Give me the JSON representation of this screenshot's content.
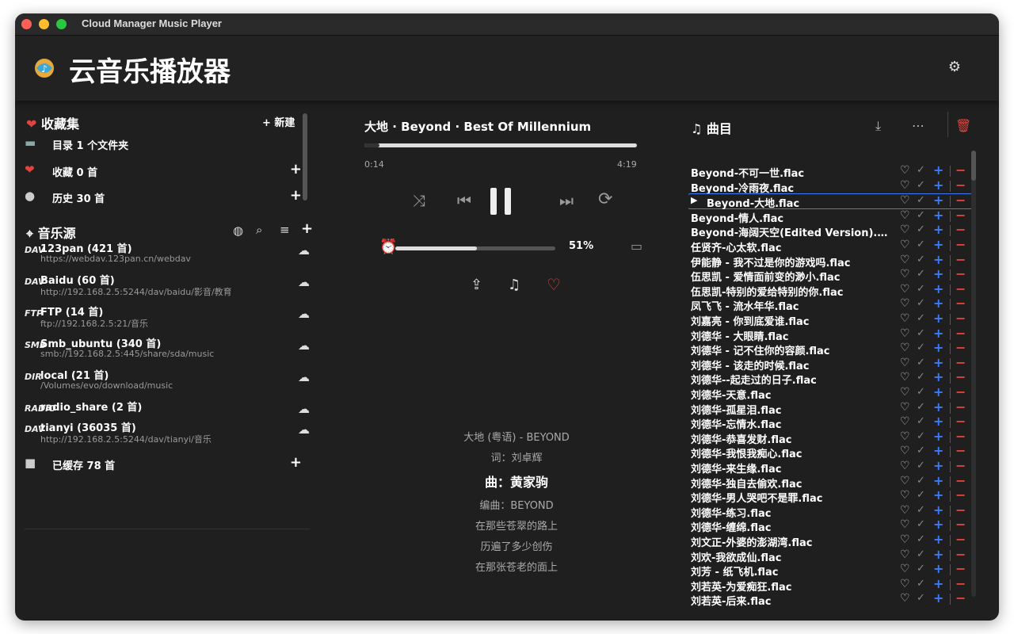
{
  "window": {
    "title": "Cloud Manager Music Player"
  },
  "app": {
    "title": "云音乐播放器"
  },
  "favorites": {
    "title": "收藏集",
    "new_label": "+ 新建",
    "items": [
      {
        "label": "目录 1 个文件夹"
      },
      {
        "label": "收藏 0 首"
      },
      {
        "label": "历史 30 首"
      }
    ]
  },
  "sources": {
    "title": "音乐源",
    "items": [
      {
        "icon": "DAV",
        "name": "123pan (421 首)",
        "url": "https://webdav.123pan.cn/webdav"
      },
      {
        "icon": "DAV",
        "name": "Baidu (60 首)",
        "url": "http://192.168.2.5:5244/dav/baidu/影音/教育"
      },
      {
        "icon": "FTP",
        "name": "FTP (14 首)",
        "url": "ftp://192.168.2.5:21/音乐"
      },
      {
        "icon": "SMB",
        "name": "Smb_ubuntu (340 首)",
        "url": "smb://192.168.2.5:445/share/sda/music"
      },
      {
        "icon": "DIR",
        "name": "local (21 首)",
        "url": "/Volumes/evo/download/music"
      },
      {
        "icon": "RADIO",
        "name": "radio_share (2 首)",
        "url": ""
      },
      {
        "icon": "DAV",
        "name": "tianyi (36035 首)",
        "url": "http://192.168.2.5:5244/dav/tianyi/音乐"
      }
    ]
  },
  "cached": {
    "label": "已缓存 78 首"
  },
  "player": {
    "now_playing": "大地 · Beyond · Best Of Millennium",
    "elapsed": "0:14",
    "duration": "4:19",
    "progress": 0.054,
    "volume_pct": "51%",
    "volume": 0.51
  },
  "lyrics": [
    {
      "text": "大地 (粤语) - BEYOND",
      "hl": false
    },
    {
      "text": "词：刘卓辉",
      "hl": false
    },
    {
      "text": "曲：黄家驹",
      "hl": true
    },
    {
      "text": "编曲：BEYOND",
      "hl": false
    },
    {
      "text": "在那些苍翠的路上",
      "hl": false
    },
    {
      "text": "历遍了多少创伤",
      "hl": false
    },
    {
      "text": "在那张苍老的面上",
      "hl": false
    }
  ],
  "playlist": {
    "title": "曲目",
    "selected_index": 2,
    "tracks": [
      "Beyond-不可一世.flac",
      "Beyond-冷雨夜.flac",
      "Beyond-大地.flac",
      "Beyond-情人.flac",
      "Beyond-海阔天空(Edited Version).flac",
      "任贤齐-心太软.flac",
      "伊能静 - 我不过是你的游戏吗.flac",
      "伍思凯 - 爱情面前变的渺小.flac",
      "伍思凯-特别的爱给特别的你.flac",
      "凤飞飞 - 流水年华.flac",
      "刘嘉亮 - 你到底爱谁.flac",
      "刘德华 - 大眼睛.flac",
      "刘德华 - 记不住你的容颜.flac",
      "刘德华 - 该走的时候.flac",
      "刘德华--起走过的日子.flac",
      "刘德华-天意.flac",
      "刘德华-孤星泪.flac",
      "刘德华-忘情水.flac",
      "刘德华-恭喜发财.flac",
      "刘德华-我恨我痴心.flac",
      "刘德华-来生缘.flac",
      "刘德华-独自去偷欢.flac",
      "刘德华-男人哭吧不是罪.flac",
      "刘德华-练习.flac",
      "刘德华-缠绵.flac",
      "刘文正-外婆的澎湖湾.flac",
      "刘欢-我欲成仙.flac",
      "刘芳 - 纸飞机.flac",
      "刘若英-为爱痴狂.flac",
      "刘若英-后来.flac"
    ]
  }
}
